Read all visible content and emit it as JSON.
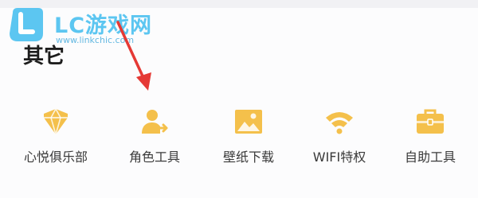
{
  "watermark": {
    "title": "LC游戏网",
    "url": "www.linkchic.com",
    "color": "#5cc6f1"
  },
  "section": {
    "title": "其它"
  },
  "items": [
    {
      "label": "心悦俱乐部",
      "icon": "diamond-badge-icon"
    },
    {
      "label": "角色工具",
      "icon": "user-transfer-icon"
    },
    {
      "label": "壁纸下载",
      "icon": "picture-icon"
    },
    {
      "label": "WIFI特权",
      "icon": "wifi-icon"
    },
    {
      "label": "自助工具",
      "icon": "toolbox-icon"
    }
  ],
  "colors": {
    "icon_accent": "#f4c04b",
    "arrow": "#e53935"
  }
}
